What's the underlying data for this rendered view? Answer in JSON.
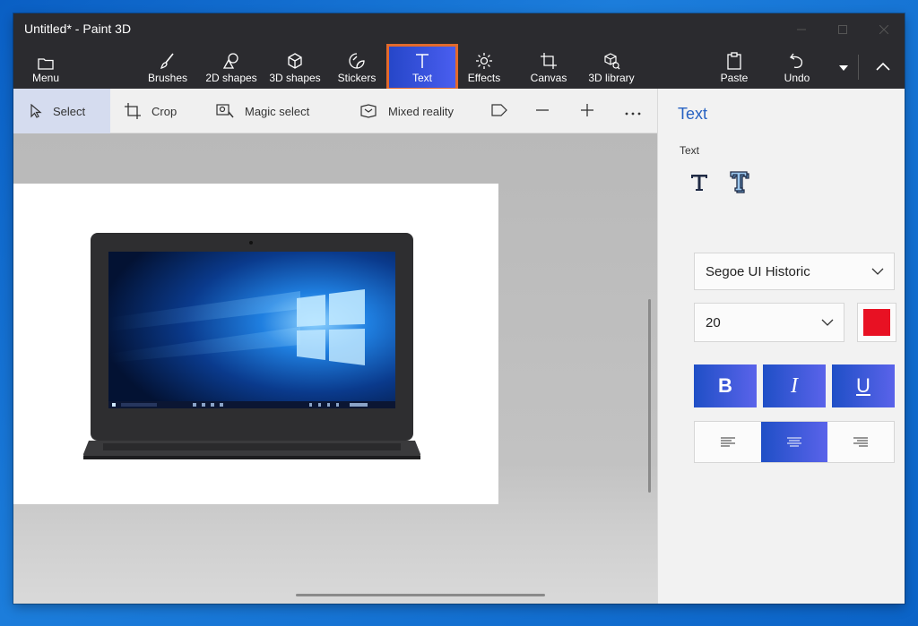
{
  "window": {
    "title": "Untitled* - Paint 3D"
  },
  "ribbon": {
    "menu_label": "Menu",
    "tabs": [
      {
        "label": "Brushes",
        "icon": "brush-icon"
      },
      {
        "label": "2D shapes",
        "icon": "2d-shapes-icon"
      },
      {
        "label": "3D shapes",
        "icon": "3d-shapes-icon"
      },
      {
        "label": "Stickers",
        "icon": "stickers-icon"
      },
      {
        "label": "Text",
        "icon": "text-icon",
        "active": true
      },
      {
        "label": "Effects",
        "icon": "effects-icon"
      },
      {
        "label": "Canvas",
        "icon": "canvas-icon"
      },
      {
        "label": "3D library",
        "icon": "3d-library-icon"
      }
    ],
    "paste_label": "Paste",
    "undo_label": "Undo"
  },
  "toolbar": {
    "select_label": "Select",
    "crop_label": "Crop",
    "magic_select_label": "Magic select",
    "mixed_reality_label": "Mixed reality"
  },
  "panel": {
    "title": "Text",
    "subtitle": "Text",
    "font_family": "Segoe UI Historic",
    "font_size": "20",
    "color": "#e81123",
    "bold_label": "B",
    "italic_label": "I",
    "underline_label": "U",
    "alignment": "center"
  },
  "colors": {
    "accent": "#2762c2",
    "highlight_outline": "#e26a2c",
    "active_gradient_start": "#1f4fc6",
    "active_gradient_end": "#5a63ea"
  }
}
